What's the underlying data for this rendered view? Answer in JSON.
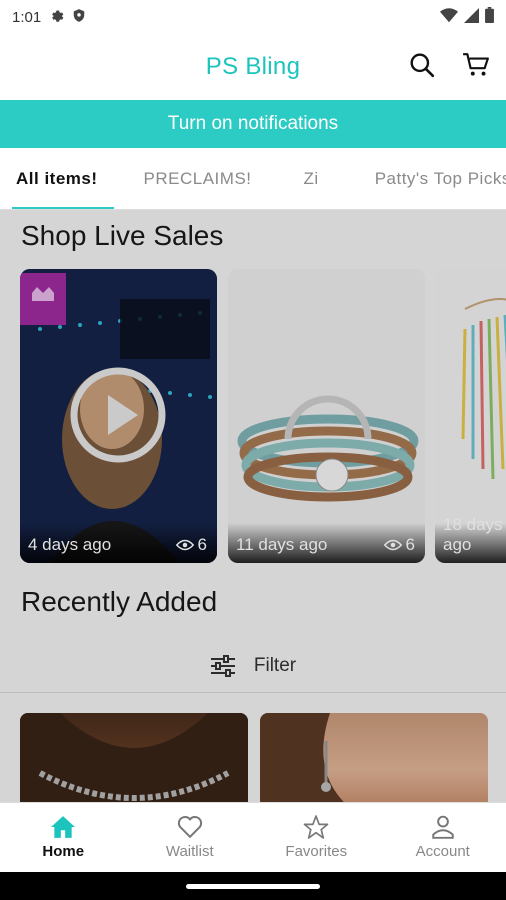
{
  "status_bar": {
    "time": "1:01",
    "icons": [
      "gear-icon",
      "shield-icon",
      "wifi-icon",
      "signal-icon",
      "battery-icon"
    ]
  },
  "header": {
    "title": "PS Bling",
    "actions": [
      "search-icon",
      "cart-icon"
    ]
  },
  "notification_bar": {
    "label": "Turn on notifications"
  },
  "tabs": [
    {
      "label": "All items!",
      "active": true
    },
    {
      "label": "PRECLAIMS!"
    },
    {
      "label": "Zi"
    },
    {
      "label": "Patty's Top Picks"
    }
  ],
  "live_sales": {
    "title": "Shop Live Sales",
    "cards": [
      {
        "age": "4 days ago",
        "views": "6"
      },
      {
        "age": "11 days ago",
        "views": "6"
      },
      {
        "age": "18 days ago",
        "views": ""
      }
    ]
  },
  "recently_added": {
    "title": "Recently Added",
    "filter_label": "Filter"
  },
  "bottom_nav": [
    {
      "label": "Home",
      "icon": "home-icon",
      "active": true
    },
    {
      "label": "Waitlist",
      "icon": "heart-icon"
    },
    {
      "label": "Favorites",
      "icon": "star-icon"
    },
    {
      "label": "Account",
      "icon": "account-icon"
    }
  ],
  "colors": {
    "brand": "#1cc4bd",
    "notification_bg": "#2ccbc4"
  }
}
